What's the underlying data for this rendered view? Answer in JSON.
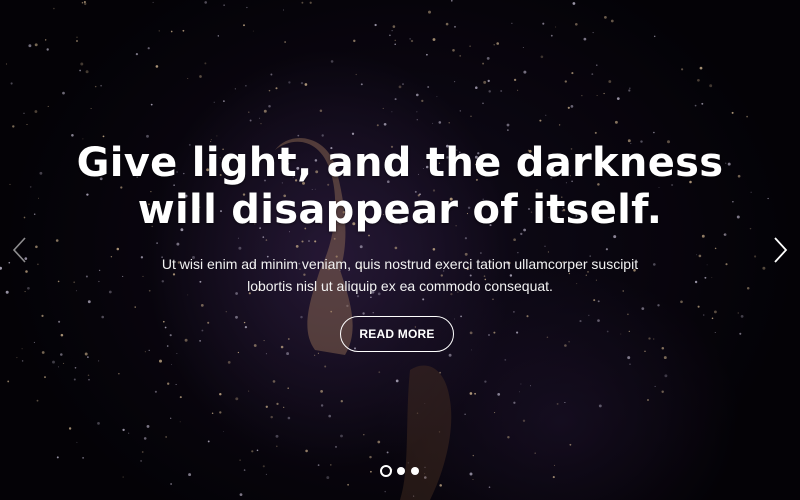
{
  "slide": {
    "headline_line1": "Give light, and the darkness",
    "headline_line2": "will disappear of itself.",
    "text_line1": "Ut wisi enim ad minim veniam, quis nostrud exerci tation ullamcorper suscipit",
    "text_line2": "lobortis nisl ut aliquip ex ea commodo consequat.",
    "button_label": "READ MORE"
  },
  "navigation": {
    "prev_icon": "chevron-left-icon",
    "next_icon": "chevron-right-icon",
    "slide_count": 3,
    "active_slide": 1
  },
  "colors": {
    "text": "#ffffff",
    "background": "#050308",
    "glow": "#462d5f"
  }
}
